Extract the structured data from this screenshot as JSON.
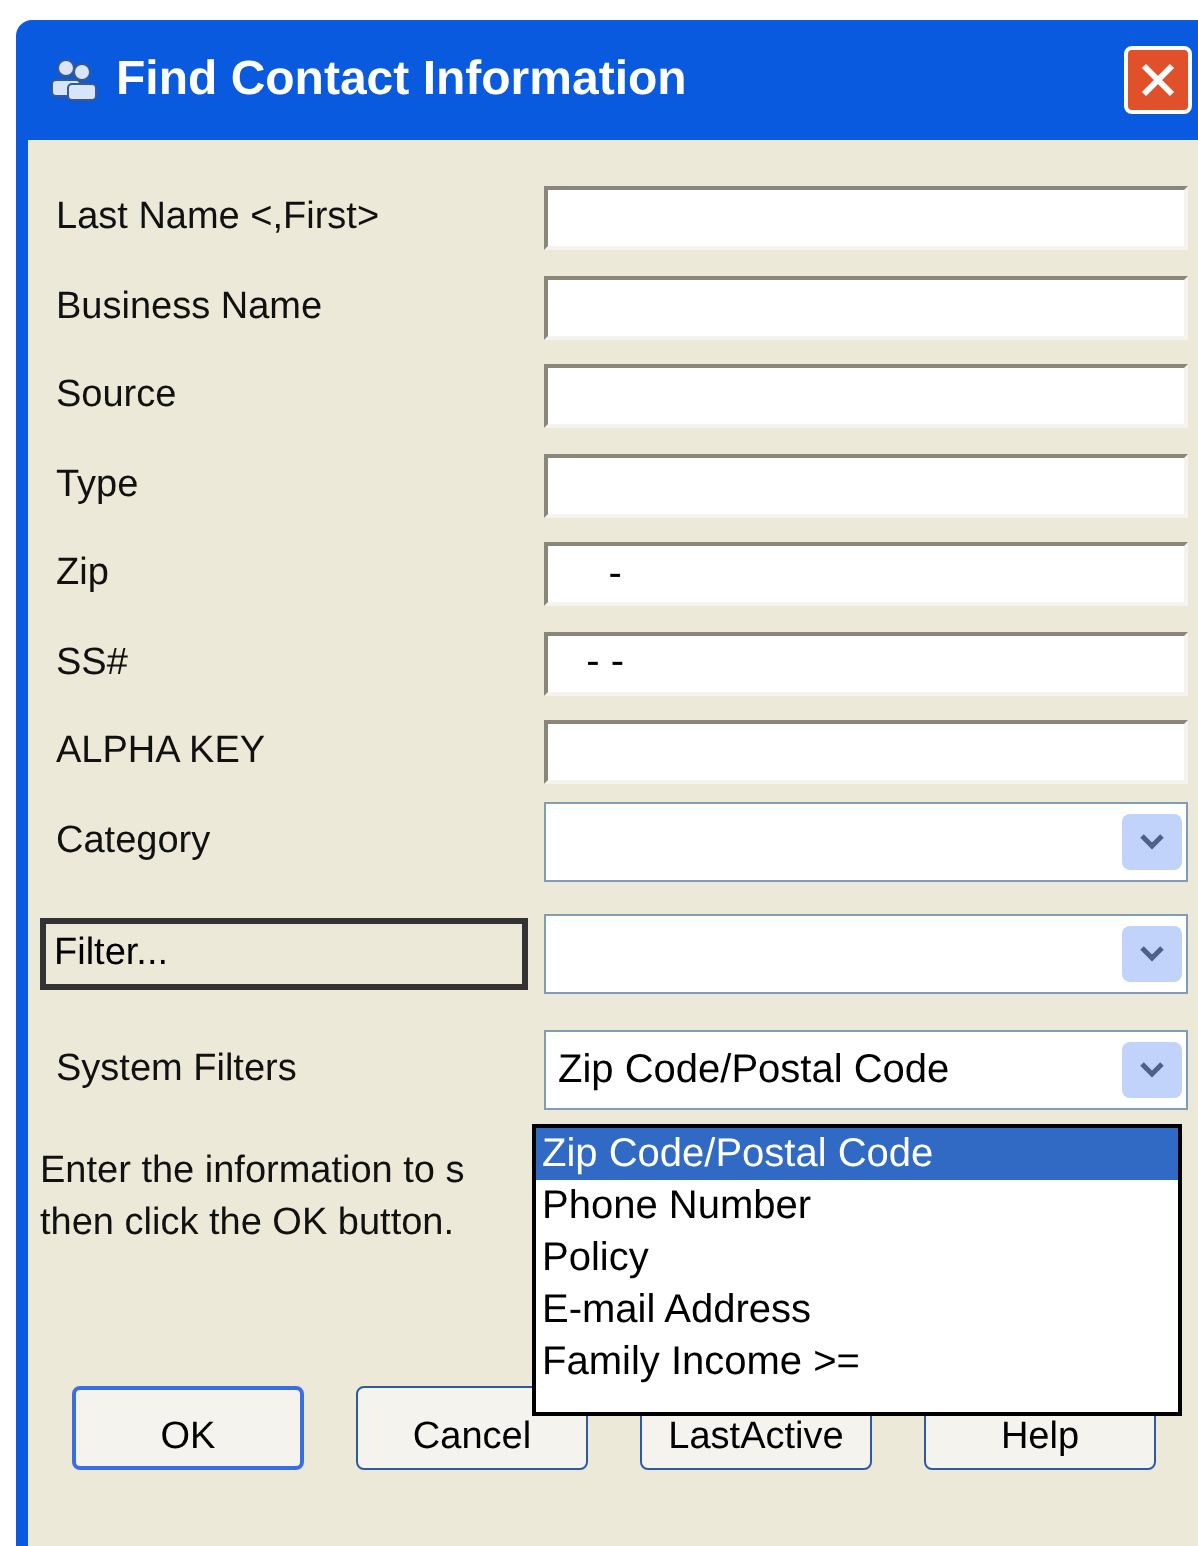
{
  "window": {
    "title": "Find Contact Information"
  },
  "fields": [
    {
      "label": "Last Name <,First>",
      "kind": "text"
    },
    {
      "label": "Business Name",
      "kind": "text"
    },
    {
      "label": "Source",
      "kind": "text"
    },
    {
      "label": "Type",
      "kind": "text"
    },
    {
      "label": "Zip",
      "kind": "text",
      "value": "    -"
    },
    {
      "label": "SS#",
      "kind": "text",
      "value": "  - -"
    },
    {
      "label": "ALPHA KEY",
      "kind": "text"
    },
    {
      "label": "Category",
      "kind": "combo"
    }
  ],
  "filter": {
    "button": "Filter..."
  },
  "system_filters": {
    "label": "System Filters",
    "value": "Zip Code/Postal Code",
    "options": [
      {
        "label": "Zip Code/Postal Code",
        "selected": true
      },
      {
        "label": "Phone Number",
        "selected": false
      },
      {
        "label": "Policy",
        "selected": false
      },
      {
        "label": "E-mail Address",
        "selected": false
      },
      {
        "label": "Family Income >=",
        "selected": false
      }
    ]
  },
  "instructions": [
    "Enter the information to s",
    "then click the OK button."
  ],
  "buttons": [
    "OK",
    "Cancel",
    "LastActive",
    "Help"
  ]
}
